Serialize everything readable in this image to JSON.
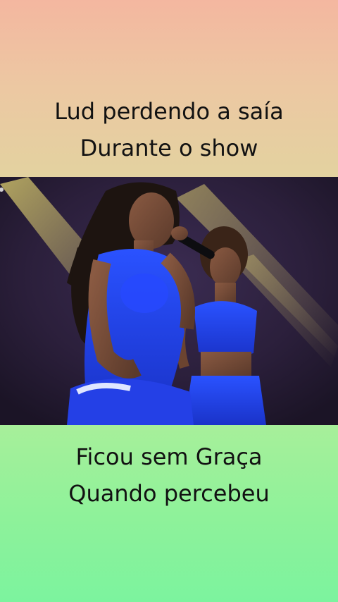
{
  "top_caption": {
    "line1": "Lud perdendo a saía",
    "line2": "Durante o show"
  },
  "video": {
    "description_icon": "concert-video-frame"
  },
  "bottom_caption": {
    "line1": "Ficou sem Graça",
    "line2": "Quando percebeu"
  },
  "colors": {
    "top_gradient_start": "#f4b7a0",
    "top_gradient_end": "#e3d2a0",
    "bottom_gradient_start": "#a7ef9a",
    "bottom_gradient_end": "#7cf39e",
    "caption_text": "#121212",
    "outfit_blue": "#1f3fd6"
  }
}
